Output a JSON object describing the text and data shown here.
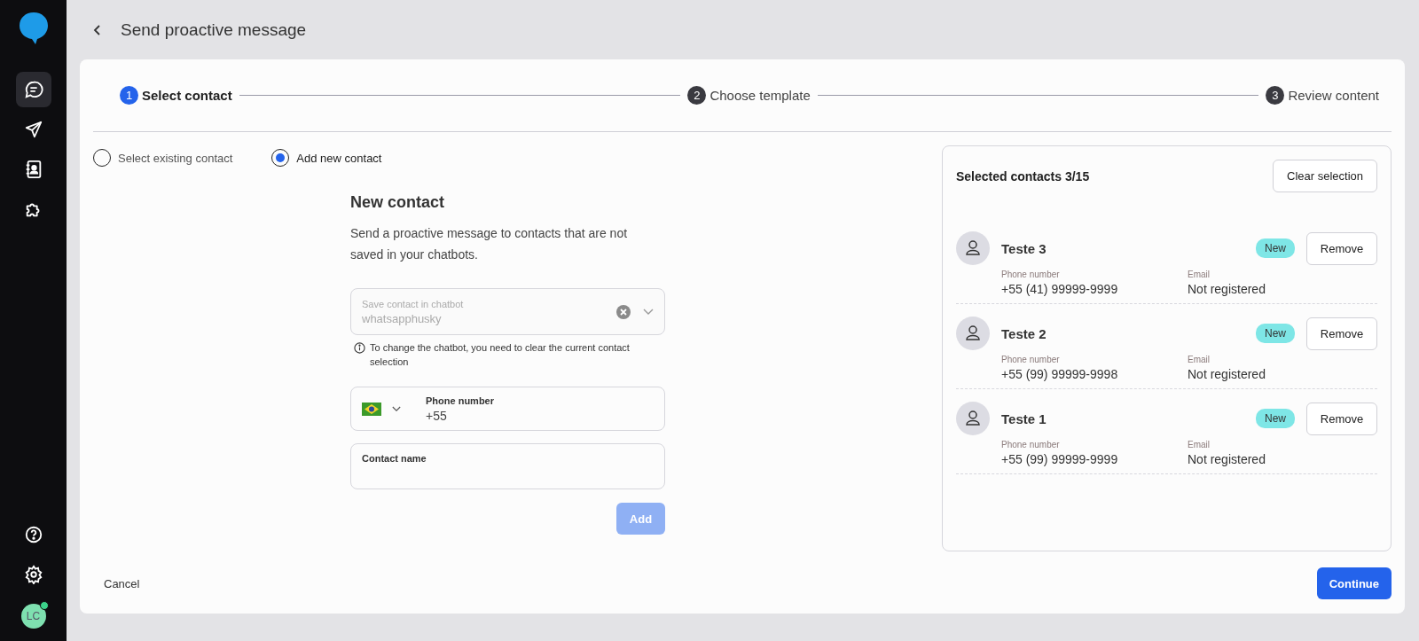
{
  "sidebar": {
    "nav_items": [
      {
        "selected": true
      },
      {
        "selected": false
      },
      {
        "selected": false
      },
      {
        "selected": false
      }
    ],
    "avatar": {
      "initials": "LC",
      "online": true
    }
  },
  "header": {
    "title": "Send proactive message"
  },
  "stepper": [
    {
      "number": "1",
      "label": "Select contact",
      "selected": true
    },
    {
      "number": "2",
      "label": "Choose template",
      "selected": false
    },
    {
      "number": "3",
      "label": "Review content",
      "selected": false
    }
  ],
  "contact_mode": [
    {
      "label": "Select existing contact",
      "selected": false
    },
    {
      "label": "Add new contact",
      "selected": true
    }
  ],
  "form": {
    "title": "New contact",
    "description": "Send a proactive message to contacts that are not saved in your chatbots.",
    "chatbot_select": {
      "label": "Save contact in chatbot",
      "value": "whatsapphusky",
      "disabled": true
    },
    "hint": "To change the chatbot, you need to clear the current contact selection",
    "phone_field": {
      "label": "Phone number",
      "value": "+55"
    },
    "name_field": {
      "label": "Contact name"
    },
    "add_button": {
      "label": "Add",
      "disabled": true
    }
  },
  "selected_panel": {
    "title": "Selected contacts 3/15",
    "clear_button": "Clear selection",
    "contacts": [
      {
        "name": "Teste 3",
        "badge": "New",
        "remove": "Remove",
        "phone_label": "Phone number",
        "phone": "+55 (41) 99999-9999",
        "email_label": "Email",
        "email": "Not registered"
      },
      {
        "name": "Teste 2",
        "badge": "New",
        "remove": "Remove",
        "phone_label": "Phone number",
        "phone": "+55 (99) 99999-9998",
        "email_label": "Email",
        "email": "Not registered"
      },
      {
        "name": "Teste 1",
        "badge": "New",
        "remove": "Remove",
        "phone_label": "Phone number",
        "phone": "+55 (99) 99999-9999",
        "email_label": "Email",
        "email": "Not registered"
      }
    ]
  },
  "footer": {
    "cancel": "Cancel",
    "continue": "Continue"
  }
}
